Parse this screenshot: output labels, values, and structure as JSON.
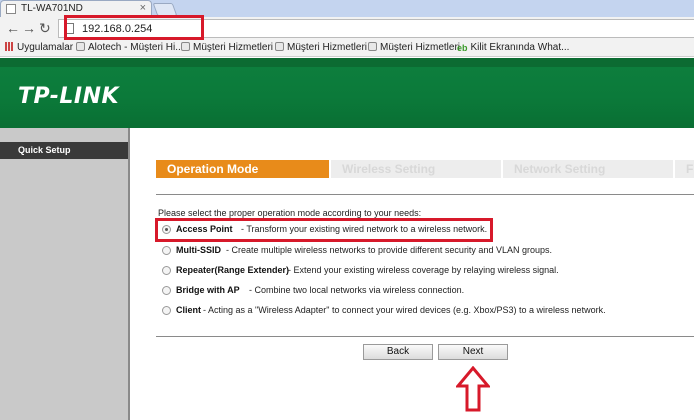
{
  "browser": {
    "tab_title": "TL-WA701ND",
    "tab_close": "×",
    "back_icon": "←",
    "forward_icon": "→",
    "reload_icon": "↻",
    "url": "192.168.0.254"
  },
  "bookmarks": [
    {
      "label": "Uygulamalar",
      "icon": "apps-icon"
    },
    {
      "label": "Alotech - Müşteri Hi...",
      "icon": "page-icon"
    },
    {
      "label": "Müşteri Hizmetleri",
      "icon": "page-icon"
    },
    {
      "label": "Müşteri Hizmetleri",
      "icon": "page-icon"
    },
    {
      "label": "Müşteri Hizmetleri",
      "icon": "page-icon"
    },
    {
      "label": "Kilit Ekranında What...",
      "icon": "kilit-icon",
      "icon_text": "eb"
    }
  ],
  "header": {
    "logo": "TP-LINK",
    "brand_color": "#0b7a3a"
  },
  "menu": {
    "items": [
      {
        "label": "Quick Setup"
      }
    ]
  },
  "steps": [
    {
      "label": "Operation Mode",
      "active": true
    },
    {
      "label": "Wireless Setting",
      "active": false
    },
    {
      "label": "Network Setting",
      "active": false
    },
    {
      "label": "Finish",
      "active": false
    }
  ],
  "instruction": "Please select the proper operation mode according to your needs:",
  "modes": [
    {
      "name": "Access Point",
      "desc": " - Transform your existing wired network to a wireless network.",
      "selected": true
    },
    {
      "name": "Multi-SSID",
      "desc": " - Create multiple wireless networks to provide different security and VLAN groups.",
      "selected": false
    },
    {
      "name": "Repeater(Range Extender)",
      "desc": " - Extend your existing wireless coverage by relaying wireless signal.",
      "selected": false
    },
    {
      "name": "Bridge with AP",
      "desc": " - Combine two local networks via wireless connection.",
      "selected": false
    },
    {
      "name": "Client",
      "desc": " - Acting as a \"Wireless Adapter\" to connect your wired devices (e.g. Xbox/PS3) to a wireless network.",
      "selected": false
    }
  ],
  "buttons": {
    "back": "Back",
    "next": "Next"
  },
  "colors": {
    "accent": "#e88b1a",
    "highlight": "#d7192a"
  }
}
